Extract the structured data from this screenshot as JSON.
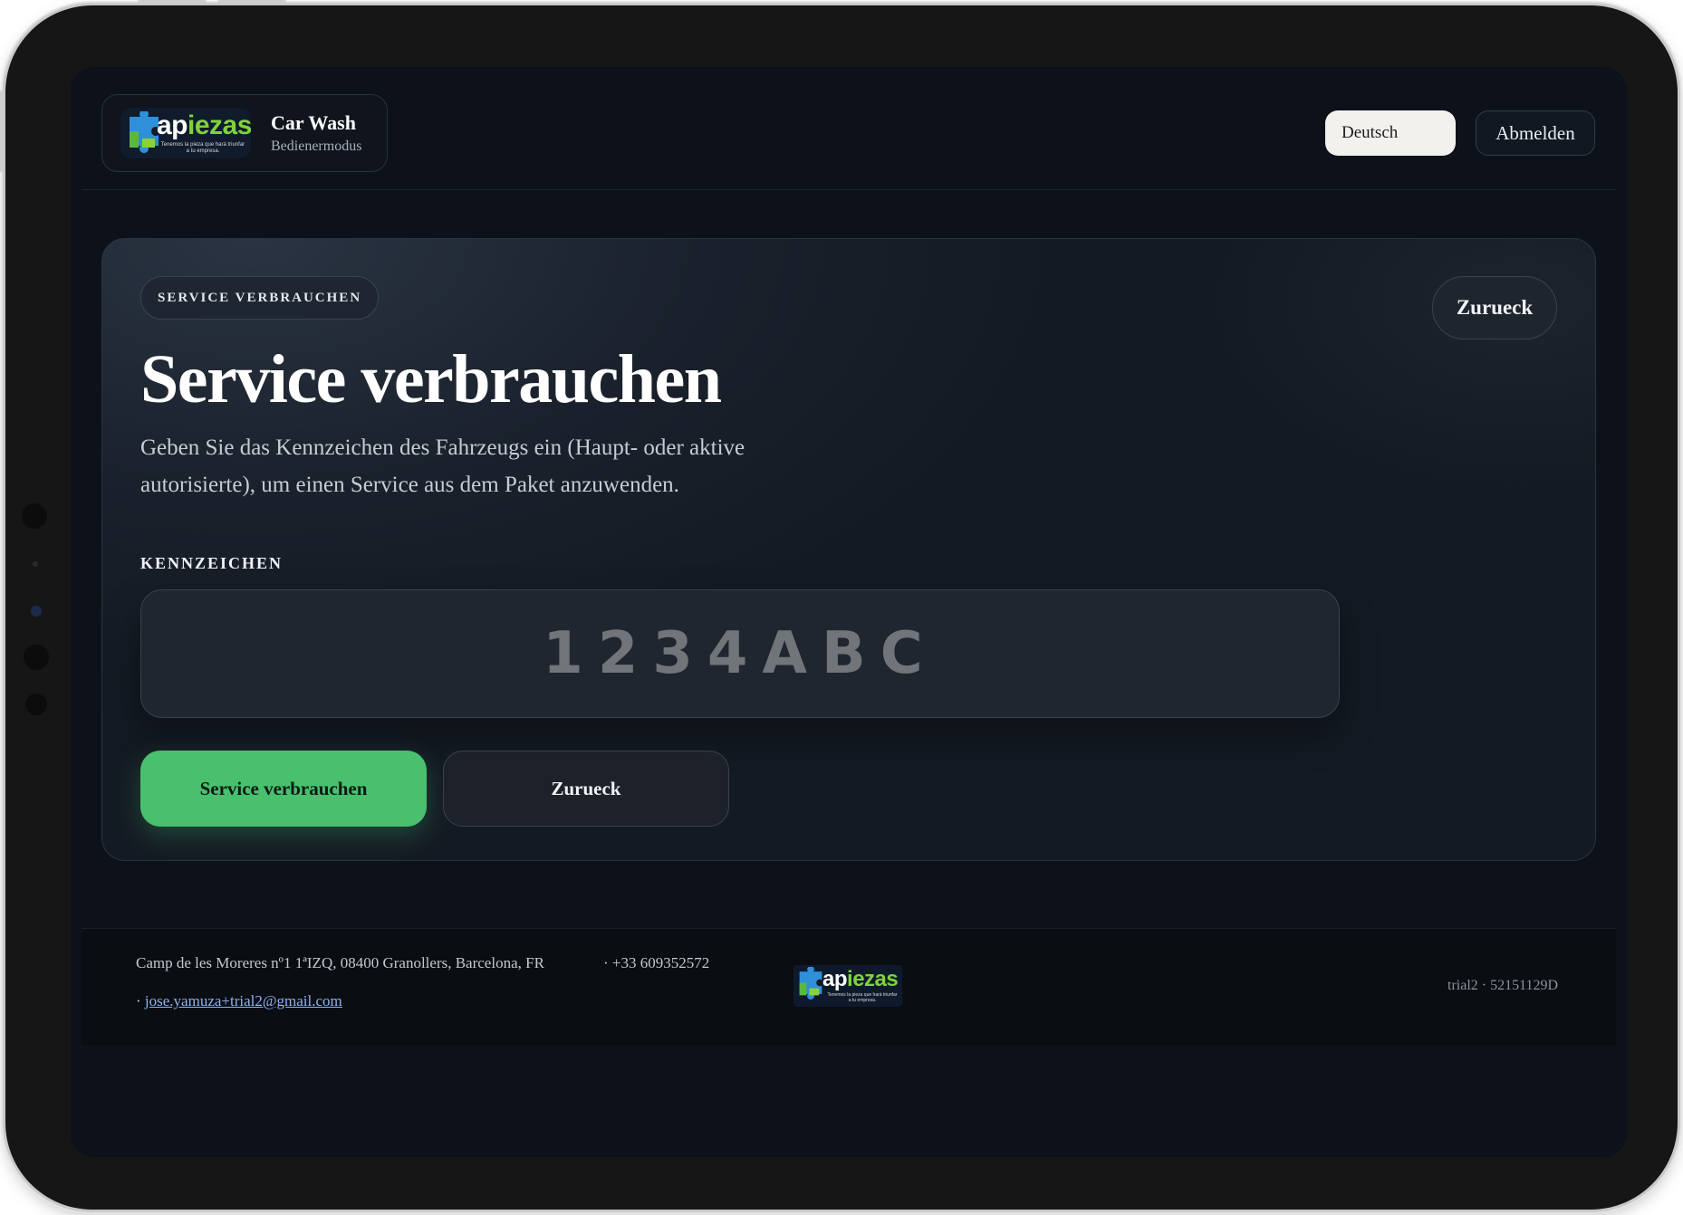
{
  "header": {
    "brand_title": "Car Wash",
    "brand_subtitle": "Bedienermodus",
    "logo": {
      "word_left": "ap",
      "word_accent": "i",
      "word_right": "ezas",
      "tagline": "Tenemos la pieza que hará triunfar a tu empresa."
    },
    "language": "Deutsch",
    "logout_label": "Abmelden"
  },
  "card": {
    "badge": "SERVICE VERBRAUCHEN",
    "back_top_label": "Zurueck",
    "title": "Service verbrauchen",
    "description": "Geben Sie das Kennzeichen des Fahrzeugs ein (Haupt- oder aktive autorisierte), um einen Service aus dem Paket anzuwenden.",
    "plate_label": "KENNZEICHEN",
    "plate_placeholder": "1234ABC",
    "primary_label": "Service verbrauchen",
    "secondary_label": "Zurueck"
  },
  "footer": {
    "address": "Camp de les Moreres nº1 1ªIZQ, 08400 Granollers, Barcelona, FR",
    "phone": "· +33 609352572",
    "email_prefix": "·",
    "email": "jose.yamuza+trial2@gmail.com",
    "account": "trial2 · 52151129D"
  },
  "colors": {
    "accent_green": "#48c06e",
    "screen_bg": "#0d111a",
    "link_blue": "#8fb3ee"
  }
}
